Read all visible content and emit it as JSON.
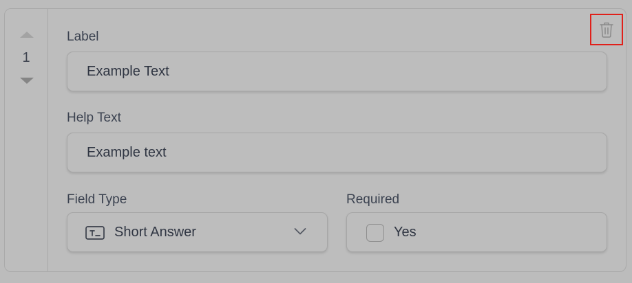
{
  "field_item": {
    "order_number": "1",
    "label": {
      "title": "Label",
      "value": "Example Text"
    },
    "help_text": {
      "title": "Help Text",
      "value": "Example text"
    },
    "field_type": {
      "title": "Field Type",
      "selected": "Short Answer",
      "icon": "short-answer-icon"
    },
    "required": {
      "title": "Required",
      "option_label": "Yes",
      "checked": false
    },
    "delete_icon": "trash-icon",
    "colors": {
      "highlight": "#e0201a"
    }
  }
}
